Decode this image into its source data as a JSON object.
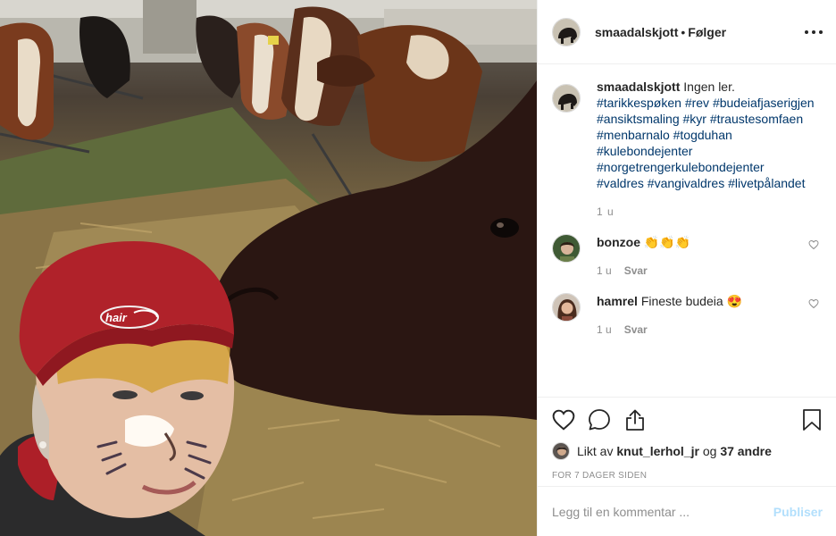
{
  "photo": {
    "icon": "cow-selfie-photo",
    "cap_logo_text": "hair"
  },
  "header": {
    "username": "smaadalskjott",
    "separator": "•",
    "follow_state": "Følger",
    "more_icon": "more-horizontal-icon"
  },
  "caption": {
    "username": "smaadalskjott",
    "text": "Ingen ler.",
    "hashtags": [
      "#tarikkespøken",
      "#rev",
      "#budeiafjaserigjen",
      "#ansiktsmaling",
      "#kyr",
      "#traustesomfaen",
      "#menbarnalo",
      "#togduhan",
      "#kulebondejenter",
      "#norgetrengerkulebondejenter",
      "#valdres",
      "#vangivaldres",
      "#livetpålandet"
    ],
    "lines": [
      "#tarikkespøken #rev #budeiafjaserigjen",
      "#ansiktsmaling #kyr #traustesomfaen",
      "#menbarnalo #togduhan",
      "#kulebondejenter",
      "#norgetrengerkulebondejenter",
      "#valdres #vangivaldres #livetpålandet"
    ],
    "age": "1 u"
  },
  "comments": [
    {
      "username": "bonzoe",
      "text": "👏👏👏",
      "age": "1 u",
      "reply": "Svar"
    },
    {
      "username": "hamrel",
      "text": "Fineste budeia 😍",
      "age": "1 u",
      "reply": "Svar"
    }
  ],
  "actions": {
    "like_icon": "heart-icon",
    "comment_icon": "comment-icon",
    "share_icon": "share-icon",
    "save_icon": "bookmark-icon"
  },
  "likes": {
    "prefix": "Likt av",
    "user": "knut_lerhol_jr",
    "conj": "og",
    "others": "37 andre"
  },
  "timestamp": "FOR 7 DAGER SIDEN",
  "add_comment": {
    "placeholder": "Legg til en kommentar ...",
    "publish_label": "Publiser"
  },
  "colors": {
    "hashtag": "#00376b",
    "text": "#262626",
    "muted": "#8e8e8e",
    "publish_disabled": "#b2dffc"
  }
}
